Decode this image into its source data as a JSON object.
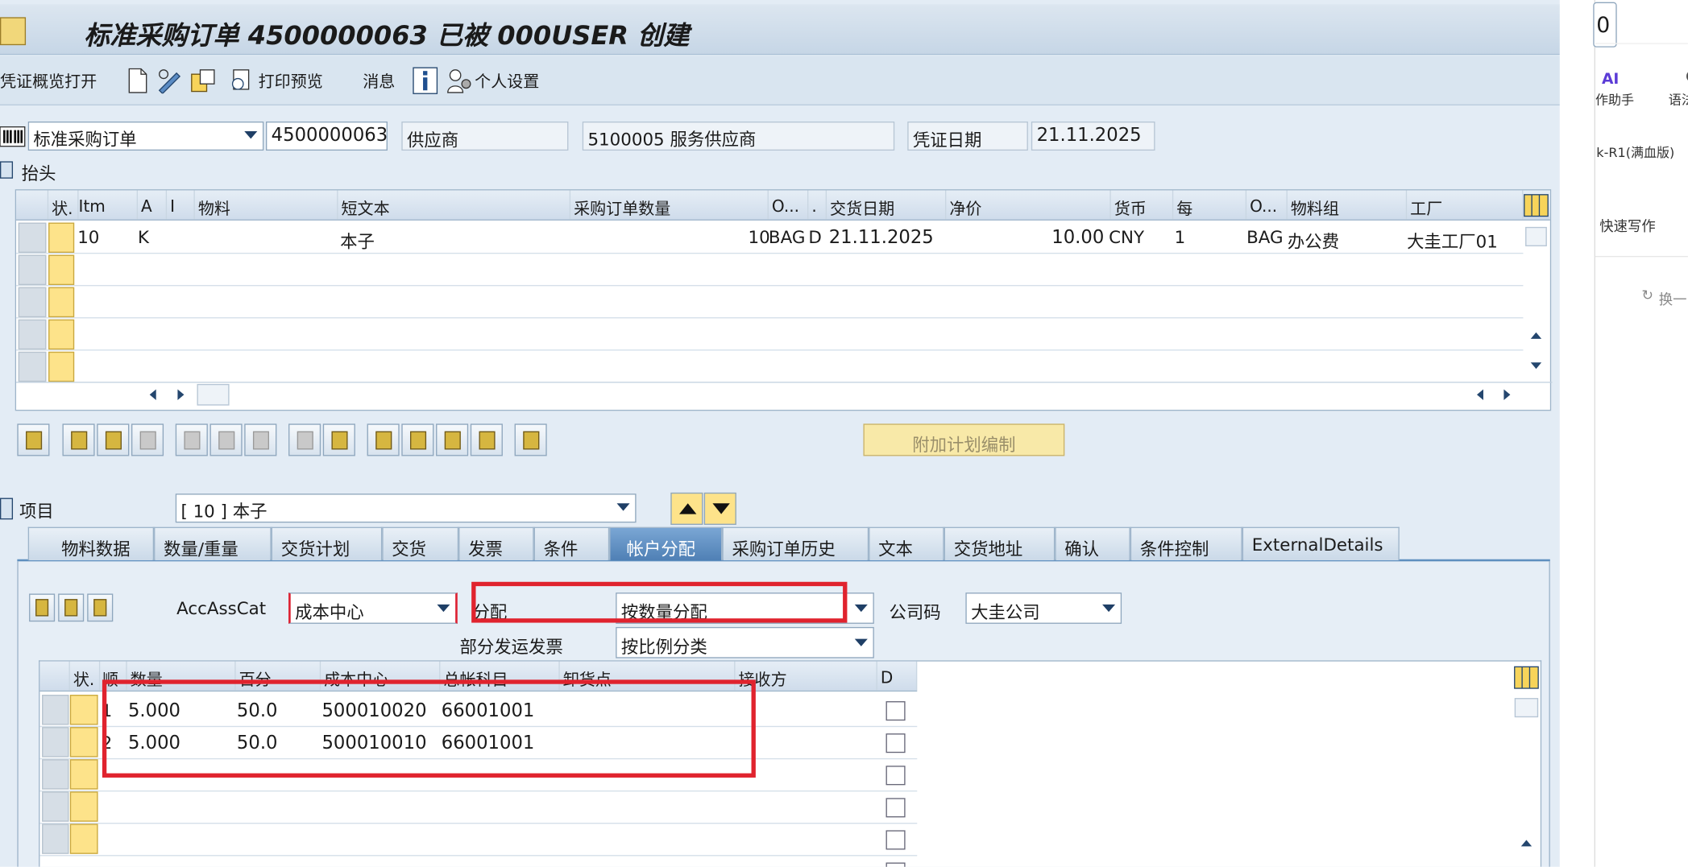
{
  "title": "标准采购订单 4500000063 已被 000USER 创建",
  "toolbar": {
    "overview": "凭证概览打开",
    "print_preview": "打印预览",
    "messages": "消息",
    "personal": "个人设置"
  },
  "header": {
    "doc_type": "标准采购订单",
    "po_number": "4500000063",
    "vendor_label": "供应商",
    "vendor_value": "5100005 服务供应商",
    "date_label": "凭证日期",
    "date_value": "21.11.2025",
    "section": "抬头"
  },
  "items_grid": {
    "columns": [
      "状.",
      "Itm",
      "A",
      "I",
      "物料",
      "短文本",
      "采购订单数量",
      "O...",
      ".",
      "交货日期",
      "净价",
      "货币",
      "每",
      "O...",
      "物料组",
      "工厂"
    ],
    "row": {
      "itm": "10",
      "a": "K",
      "short_text": "本子",
      "qty": "10",
      "uom": "BAG",
      "d": "D",
      "date": "21.11.2025",
      "price": "10.00",
      "currency": "CNY",
      "per": "1",
      "oun": "BAG",
      "matgrp": "办公费",
      "plant": "大圭工厂01"
    }
  },
  "extra_button": "附加计划编制",
  "item": {
    "label": "项目",
    "value": "[ 10 ] 本子"
  },
  "tabs": [
    "物料数据",
    "数量/重量",
    "交货计划",
    "交货",
    "发票",
    "条件",
    "帐户分配",
    "采购订单历史",
    "文本",
    "交货地址",
    "确认",
    "条件控制",
    "ExternalDetails"
  ],
  "account": {
    "cat_label": "AccAssCat",
    "cat_value": "成本中心",
    "dist_label": "分配",
    "dist_value": "按数量分配",
    "company_label": "公司码",
    "company_value": "大圭公司",
    "partial_label": "部分发运发票",
    "partial_value": "按比例分类"
  },
  "acct_grid": {
    "columns": [
      "状.",
      "顺",
      "数量",
      "百分",
      "成本中心",
      "总帐科目",
      "卸货点",
      "接收方",
      "D"
    ],
    "rows": [
      {
        "seq": "1",
        "qty": "5.000",
        "pct": "50.0",
        "cc": "500010020",
        "gl": "66001001"
      },
      {
        "seq": "2",
        "qty": "5.000",
        "pct": "50.0",
        "cc": "500010010",
        "gl": "66001001"
      }
    ]
  },
  "side_panel": {
    "top": "0",
    "assist": "作助手",
    "grammar": "语法",
    "model": "k-R1(满血版)",
    "write": "快速写作",
    "refresh": "换一"
  }
}
